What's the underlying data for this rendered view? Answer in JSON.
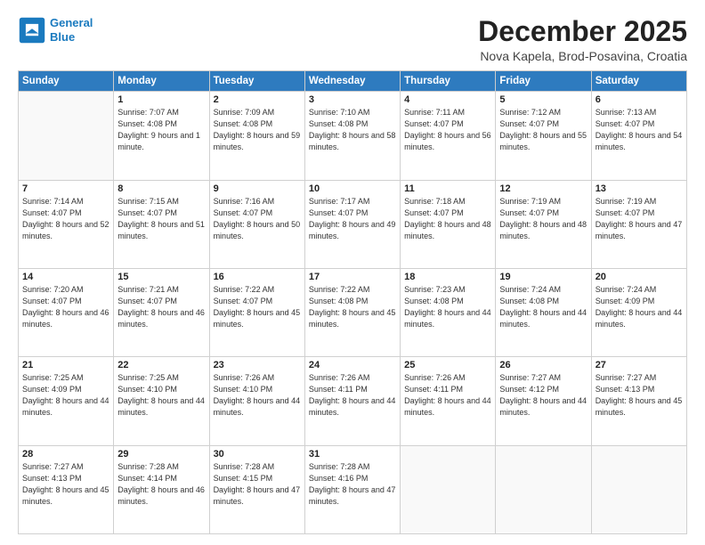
{
  "logo": {
    "line1": "General",
    "line2": "Blue"
  },
  "header": {
    "month": "December 2025",
    "location": "Nova Kapela, Brod-Posavina, Croatia"
  },
  "weekdays": [
    "Sunday",
    "Monday",
    "Tuesday",
    "Wednesday",
    "Thursday",
    "Friday",
    "Saturday"
  ],
  "weeks": [
    [
      {
        "day": "",
        "sunrise": "",
        "sunset": "",
        "daylight": ""
      },
      {
        "day": "1",
        "sunrise": "Sunrise: 7:07 AM",
        "sunset": "Sunset: 4:08 PM",
        "daylight": "Daylight: 9 hours and 1 minute."
      },
      {
        "day": "2",
        "sunrise": "Sunrise: 7:09 AM",
        "sunset": "Sunset: 4:08 PM",
        "daylight": "Daylight: 8 hours and 59 minutes."
      },
      {
        "day": "3",
        "sunrise": "Sunrise: 7:10 AM",
        "sunset": "Sunset: 4:08 PM",
        "daylight": "Daylight: 8 hours and 58 minutes."
      },
      {
        "day": "4",
        "sunrise": "Sunrise: 7:11 AM",
        "sunset": "Sunset: 4:07 PM",
        "daylight": "Daylight: 8 hours and 56 minutes."
      },
      {
        "day": "5",
        "sunrise": "Sunrise: 7:12 AM",
        "sunset": "Sunset: 4:07 PM",
        "daylight": "Daylight: 8 hours and 55 minutes."
      },
      {
        "day": "6",
        "sunrise": "Sunrise: 7:13 AM",
        "sunset": "Sunset: 4:07 PM",
        "daylight": "Daylight: 8 hours and 54 minutes."
      }
    ],
    [
      {
        "day": "7",
        "sunrise": "Sunrise: 7:14 AM",
        "sunset": "Sunset: 4:07 PM",
        "daylight": "Daylight: 8 hours and 52 minutes."
      },
      {
        "day": "8",
        "sunrise": "Sunrise: 7:15 AM",
        "sunset": "Sunset: 4:07 PM",
        "daylight": "Daylight: 8 hours and 51 minutes."
      },
      {
        "day": "9",
        "sunrise": "Sunrise: 7:16 AM",
        "sunset": "Sunset: 4:07 PM",
        "daylight": "Daylight: 8 hours and 50 minutes."
      },
      {
        "day": "10",
        "sunrise": "Sunrise: 7:17 AM",
        "sunset": "Sunset: 4:07 PM",
        "daylight": "Daylight: 8 hours and 49 minutes."
      },
      {
        "day": "11",
        "sunrise": "Sunrise: 7:18 AM",
        "sunset": "Sunset: 4:07 PM",
        "daylight": "Daylight: 8 hours and 48 minutes."
      },
      {
        "day": "12",
        "sunrise": "Sunrise: 7:19 AM",
        "sunset": "Sunset: 4:07 PM",
        "daylight": "Daylight: 8 hours and 48 minutes."
      },
      {
        "day": "13",
        "sunrise": "Sunrise: 7:19 AM",
        "sunset": "Sunset: 4:07 PM",
        "daylight": "Daylight: 8 hours and 47 minutes."
      }
    ],
    [
      {
        "day": "14",
        "sunrise": "Sunrise: 7:20 AM",
        "sunset": "Sunset: 4:07 PM",
        "daylight": "Daylight: 8 hours and 46 minutes."
      },
      {
        "day": "15",
        "sunrise": "Sunrise: 7:21 AM",
        "sunset": "Sunset: 4:07 PM",
        "daylight": "Daylight: 8 hours and 46 minutes."
      },
      {
        "day": "16",
        "sunrise": "Sunrise: 7:22 AM",
        "sunset": "Sunset: 4:07 PM",
        "daylight": "Daylight: 8 hours and 45 minutes."
      },
      {
        "day": "17",
        "sunrise": "Sunrise: 7:22 AM",
        "sunset": "Sunset: 4:08 PM",
        "daylight": "Daylight: 8 hours and 45 minutes."
      },
      {
        "day": "18",
        "sunrise": "Sunrise: 7:23 AM",
        "sunset": "Sunset: 4:08 PM",
        "daylight": "Daylight: 8 hours and 44 minutes."
      },
      {
        "day": "19",
        "sunrise": "Sunrise: 7:24 AM",
        "sunset": "Sunset: 4:08 PM",
        "daylight": "Daylight: 8 hours and 44 minutes."
      },
      {
        "day": "20",
        "sunrise": "Sunrise: 7:24 AM",
        "sunset": "Sunset: 4:09 PM",
        "daylight": "Daylight: 8 hours and 44 minutes."
      }
    ],
    [
      {
        "day": "21",
        "sunrise": "Sunrise: 7:25 AM",
        "sunset": "Sunset: 4:09 PM",
        "daylight": "Daylight: 8 hours and 44 minutes."
      },
      {
        "day": "22",
        "sunrise": "Sunrise: 7:25 AM",
        "sunset": "Sunset: 4:10 PM",
        "daylight": "Daylight: 8 hours and 44 minutes."
      },
      {
        "day": "23",
        "sunrise": "Sunrise: 7:26 AM",
        "sunset": "Sunset: 4:10 PM",
        "daylight": "Daylight: 8 hours and 44 minutes."
      },
      {
        "day": "24",
        "sunrise": "Sunrise: 7:26 AM",
        "sunset": "Sunset: 4:11 PM",
        "daylight": "Daylight: 8 hours and 44 minutes."
      },
      {
        "day": "25",
        "sunrise": "Sunrise: 7:26 AM",
        "sunset": "Sunset: 4:11 PM",
        "daylight": "Daylight: 8 hours and 44 minutes."
      },
      {
        "day": "26",
        "sunrise": "Sunrise: 7:27 AM",
        "sunset": "Sunset: 4:12 PM",
        "daylight": "Daylight: 8 hours and 44 minutes."
      },
      {
        "day": "27",
        "sunrise": "Sunrise: 7:27 AM",
        "sunset": "Sunset: 4:13 PM",
        "daylight": "Daylight: 8 hours and 45 minutes."
      }
    ],
    [
      {
        "day": "28",
        "sunrise": "Sunrise: 7:27 AM",
        "sunset": "Sunset: 4:13 PM",
        "daylight": "Daylight: 8 hours and 45 minutes."
      },
      {
        "day": "29",
        "sunrise": "Sunrise: 7:28 AM",
        "sunset": "Sunset: 4:14 PM",
        "daylight": "Daylight: 8 hours and 46 minutes."
      },
      {
        "day": "30",
        "sunrise": "Sunrise: 7:28 AM",
        "sunset": "Sunset: 4:15 PM",
        "daylight": "Daylight: 8 hours and 47 minutes."
      },
      {
        "day": "31",
        "sunrise": "Sunrise: 7:28 AM",
        "sunset": "Sunset: 4:16 PM",
        "daylight": "Daylight: 8 hours and 47 minutes."
      },
      {
        "day": "",
        "sunrise": "",
        "sunset": "",
        "daylight": ""
      },
      {
        "day": "",
        "sunrise": "",
        "sunset": "",
        "daylight": ""
      },
      {
        "day": "",
        "sunrise": "",
        "sunset": "",
        "daylight": ""
      }
    ]
  ]
}
